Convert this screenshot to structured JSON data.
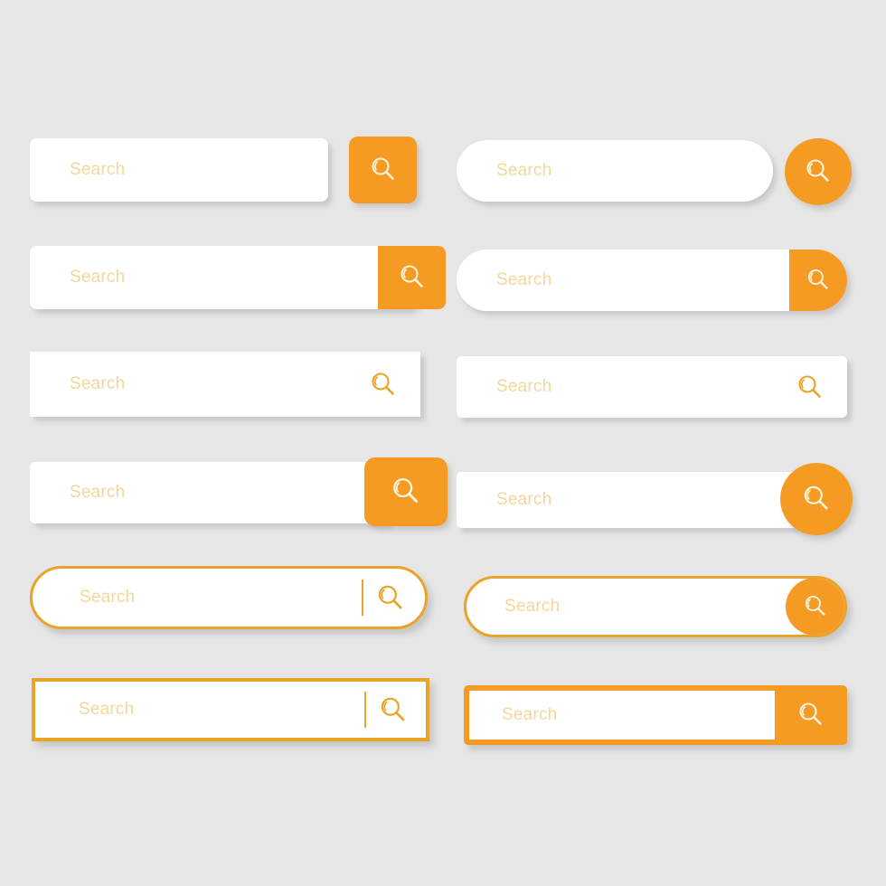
{
  "page": {
    "title": "Search Bar UI Kit",
    "background_color": "#e6e6e6",
    "accent_color": "#f59b23",
    "outline_color": "#eaa329",
    "placeholder_color": "#f3d79a",
    "field_color": "#ffffff",
    "icon_name": "magnifier-icon"
  },
  "search_bars": [
    {
      "id": "sb-1",
      "variant": "rounded-field-separate-square-button",
      "column": "left",
      "row": 1,
      "placeholder": "Search",
      "value": "",
      "button_icon": "magnifier-icon",
      "button_icon_color": "#fdf3dc",
      "button_fill": "#f59b23"
    },
    {
      "id": "sb-2",
      "variant": "pill-field-separate-circle-button",
      "column": "right",
      "row": 1,
      "placeholder": "Search",
      "value": "",
      "button_icon": "magnifier-icon",
      "button_icon_color": "#fdf3dc",
      "button_fill": "#f59b23"
    },
    {
      "id": "sb-3",
      "variant": "rounded-field-attached-square-button",
      "column": "left",
      "row": 2,
      "placeholder": "Search",
      "value": "",
      "button_icon": "magnifier-icon",
      "button_icon_color": "#fdf3dc",
      "button_fill": "#f59b23"
    },
    {
      "id": "sb-4",
      "variant": "pill-field-attached-rounded-end-button",
      "column": "right",
      "row": 2,
      "placeholder": "Search",
      "value": "",
      "button_icon": "magnifier-icon",
      "button_icon_color": "#fdf3dc",
      "button_fill": "#f59b23"
    },
    {
      "id": "sb-5",
      "variant": "flat-square-field-inline-icon",
      "column": "left",
      "row": 3,
      "placeholder": "Search",
      "value": "",
      "button_icon": "magnifier-icon",
      "button_icon_color": "#eaa329",
      "button_fill": "none"
    },
    {
      "id": "sb-6",
      "variant": "rounded-field-inline-icon",
      "column": "right",
      "row": 3,
      "placeholder": "Search",
      "value": "",
      "button_icon": "magnifier-icon",
      "button_icon_color": "#eaa329",
      "button_fill": "none"
    },
    {
      "id": "sb-7",
      "variant": "flat-field-overlapping-rounded-button",
      "column": "left",
      "row": 4,
      "placeholder": "Search",
      "value": "",
      "button_icon": "magnifier-icon",
      "button_icon_color": "#fdf3dc",
      "button_fill": "#f59b23"
    },
    {
      "id": "sb-8",
      "variant": "rounded-field-overlapping-circle-button",
      "column": "right",
      "row": 4,
      "placeholder": "Search",
      "value": "",
      "button_icon": "magnifier-icon",
      "button_icon_color": "#fdf3dc",
      "button_fill": "#f59b23"
    },
    {
      "id": "sb-9",
      "variant": "outlined-pill-field-divider-icon",
      "column": "left",
      "row": 5,
      "placeholder": "Search",
      "value": "",
      "button_icon": "magnifier-icon",
      "button_icon_color": "#eaa329",
      "button_fill": "none",
      "has_divider": true
    },
    {
      "id": "sb-10",
      "variant": "outlined-pill-field-filled-circle-button",
      "column": "right",
      "row": 5,
      "placeholder": "Search",
      "value": "",
      "button_icon": "magnifier-icon",
      "button_icon_color": "#fdf3dc",
      "button_fill": "#f59b23"
    },
    {
      "id": "sb-11",
      "variant": "outlined-rect-field-divider-icon",
      "column": "left",
      "row": 6,
      "placeholder": "Search",
      "value": "",
      "button_icon": "magnifier-icon",
      "button_icon_color": "#eaa329",
      "button_fill": "none",
      "has_divider": true
    },
    {
      "id": "sb-12",
      "variant": "outlined-rect-field-filled-square-button",
      "column": "right",
      "row": 6,
      "placeholder": "Search",
      "value": "",
      "button_icon": "magnifier-icon",
      "button_icon_color": "#fdf3dc",
      "button_fill": "#f59b23"
    }
  ]
}
